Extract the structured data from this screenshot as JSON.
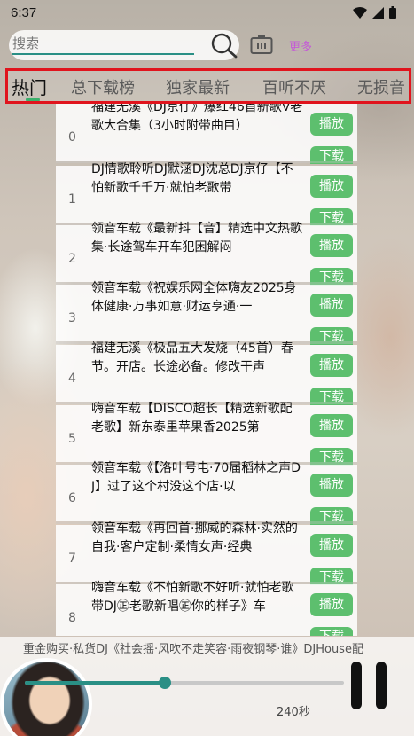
{
  "status": {
    "time": "6:37"
  },
  "search": {
    "placeholder": "搜索"
  },
  "header": {
    "more": "更多"
  },
  "tabs": [
    "热门",
    "总下载榜",
    "独家最新",
    "百听不厌",
    "无损音"
  ],
  "songs": [
    {
      "index": "0",
      "title": "福建无溪《DJ京仔》爆红46首新歌V老歌大合集（3小时附带曲目）"
    },
    {
      "index": "1",
      "title": "DJ情歌聆听DJ默涵DJ沈总DJ京仔【不怕新歌千千万·就怕老歌带"
    },
    {
      "index": "2",
      "title": "领音车载《最新抖【音】精选中文热歌集·长途驾车开车犯困解闷"
    },
    {
      "index": "3",
      "title": "领音车载《祝娱乐网全体嗨友2025身体健康·万事如意·财运亨通·一"
    },
    {
      "index": "4",
      "title": "福建无溪《极品五大发烧（45首）春节。开店。长途必备。修改干声"
    },
    {
      "index": "5",
      "title": "嗨音车载【DISCO超长【精选新歌配老歌】新东泰里苹果香2025第"
    },
    {
      "index": "6",
      "title": "领音车载《【洛叶号电·70届稻林之声DJ】过了这个村没这个店·以"
    },
    {
      "index": "7",
      "title": "领音车载《再回首·挪威的森林·实然的自我·客户定制·柔情女声·经典"
    },
    {
      "index": "8",
      "title": "嗨音车载《不怕新歌不好听·就怕老歌带DJ㊣老歌新唱㊣你的样子》车"
    }
  ],
  "buttons": {
    "play": "播放",
    "download": "下载"
  },
  "player": {
    "now_playing": "重金购买·私货DJ《社会摇·风吹不走笑容·雨夜钢琴·谁》DJHouse配",
    "duration": "240秒",
    "progress": 0.44
  },
  "colors": {
    "accent": "#2a8f85",
    "button": "#5dbf6e",
    "tab_outline": "#e0141d",
    "more": "#c45bd6"
  },
  "icons": [
    "search-icon",
    "tv-icon",
    "wifi-icon",
    "signal-icon",
    "battery-icon",
    "pause-icon"
  ]
}
